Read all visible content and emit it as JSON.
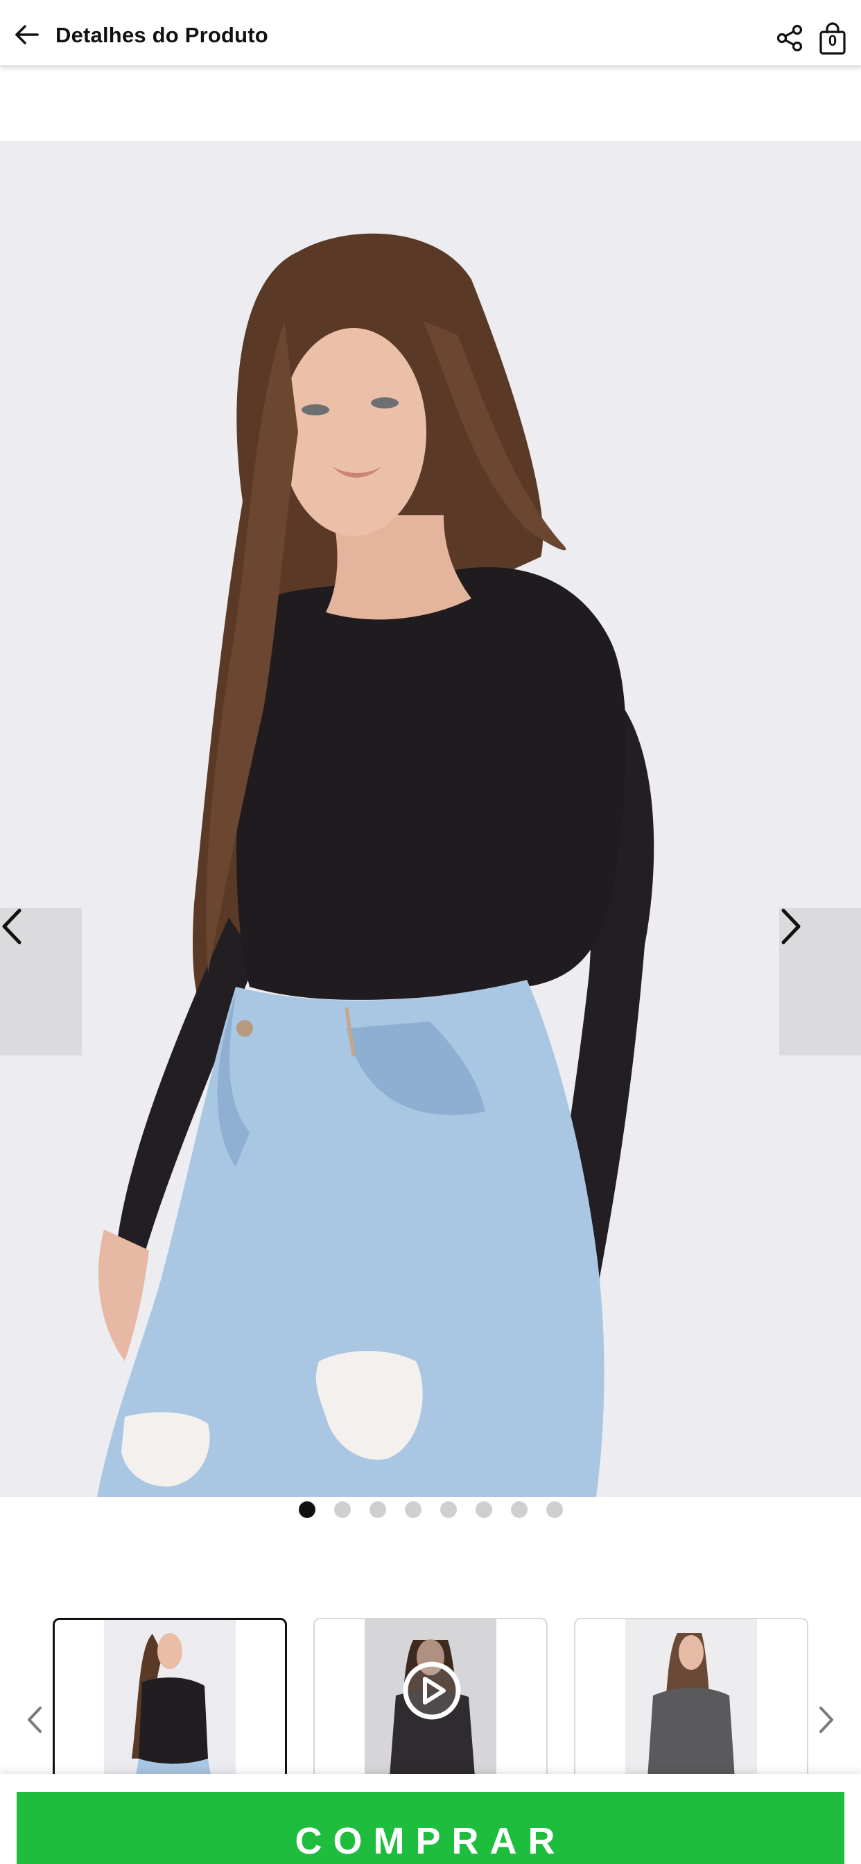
{
  "header": {
    "title": "Detalhes do Produto",
    "cart_count": "0",
    "icons": {
      "back": "arrow-left-icon",
      "share": "share-icon",
      "cart": "shopping-bag-icon"
    }
  },
  "gallery": {
    "image_count": 8,
    "active_index": 0,
    "prev_icon": "chevron-left-icon",
    "next_icon": "chevron-right-icon"
  },
  "thumbnails": {
    "items": [
      {
        "kind": "image",
        "selected": true
      },
      {
        "kind": "video",
        "selected": false,
        "icon": "play-circle-icon"
      },
      {
        "kind": "image",
        "selected": false
      }
    ]
  },
  "actions": {
    "buy_label": "COMPRAR"
  },
  "colors": {
    "buy_button": "#1ebd3d",
    "active_dot": "#111111",
    "inactive_dot": "#cfcfcf"
  }
}
